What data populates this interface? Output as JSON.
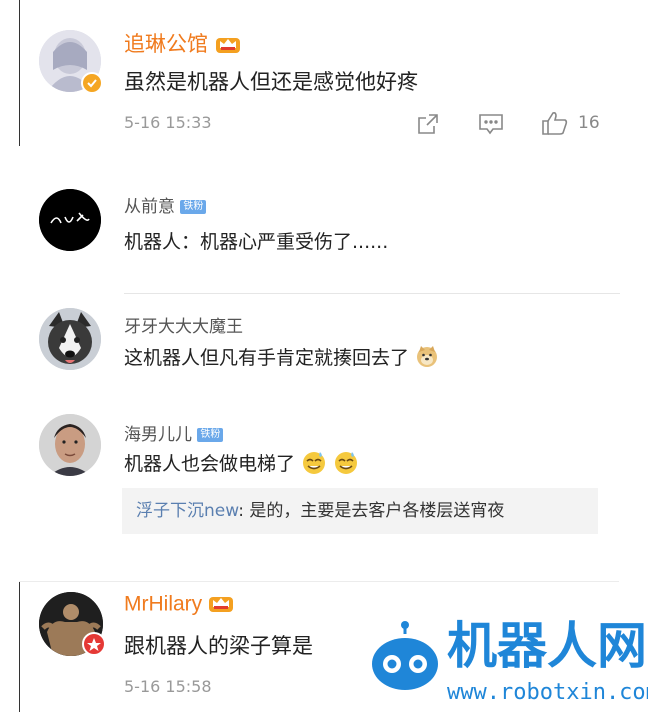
{
  "comments": [
    {
      "user": "追琳公馆",
      "text": "虽然是机器人但还是感觉他好疼",
      "time": "5-16 15:33",
      "likes": "16",
      "badge": "crown"
    },
    {
      "user": "从前意",
      "badge": "铁粉",
      "text": "机器人：机器心严重受伤了......"
    },
    {
      "user": "牙牙大大大魔王",
      "text": "这机器人但凡有手肯定就揍回去了"
    },
    {
      "user": "海男儿儿",
      "badge": "铁粉",
      "text": "机器人也会做电梯了",
      "reply": {
        "user": "浮子下沉new",
        "text": ": 是的，主要是去客户各楼层送宵夜"
      }
    },
    {
      "user": "MrHilary",
      "text": "跟机器人的梁子算是",
      "time": "5-16 15:58",
      "badge": "crown"
    }
  ],
  "watermark": {
    "title": "机器人网",
    "url": "www.robotxin.com"
  },
  "colors": {
    "accent_orange": "#f07b1e",
    "link_blue": "#5a7fb0",
    "badge_blue": "#6aa8ea",
    "watermark_blue": "#1f86d8"
  }
}
